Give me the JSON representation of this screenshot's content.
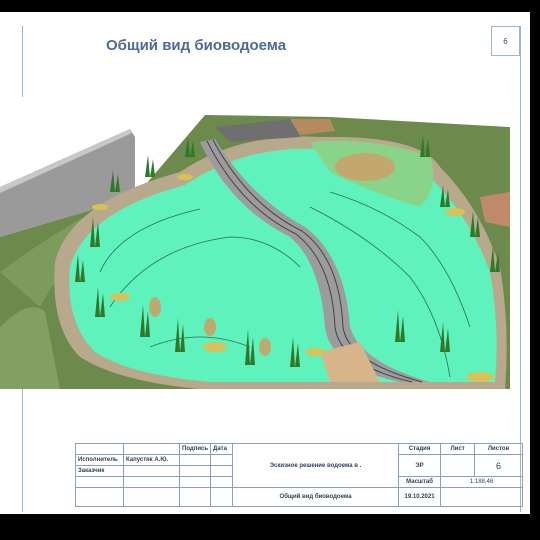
{
  "sheet": {
    "number": "6",
    "title": "Общий вид биоводоема"
  },
  "stamp": {
    "col_signature": "Подпись",
    "col_date": "Дата",
    "executor_label": "Исполнитель",
    "executor_name": "Капустяк А.Ю.",
    "customer_label": "Заказчик",
    "project_title": "Эскизное решение водоема в .",
    "drawing_title": "Общий вид биоводоема",
    "stage_label": "Стадия",
    "sheet_label": "Лист",
    "sheets_label": "Листов",
    "stage_value": "ЭР",
    "sheets_value": "6",
    "scale_label": "Масштаб",
    "scale_value": "1:188,46",
    "date_value": "19.10.2021"
  },
  "colors": {
    "title": "#4a6b9a",
    "water": "#5ff2bc",
    "terrain": "#6e8f50",
    "path": "#8a8a8a",
    "frame": "#9bb6cf"
  }
}
